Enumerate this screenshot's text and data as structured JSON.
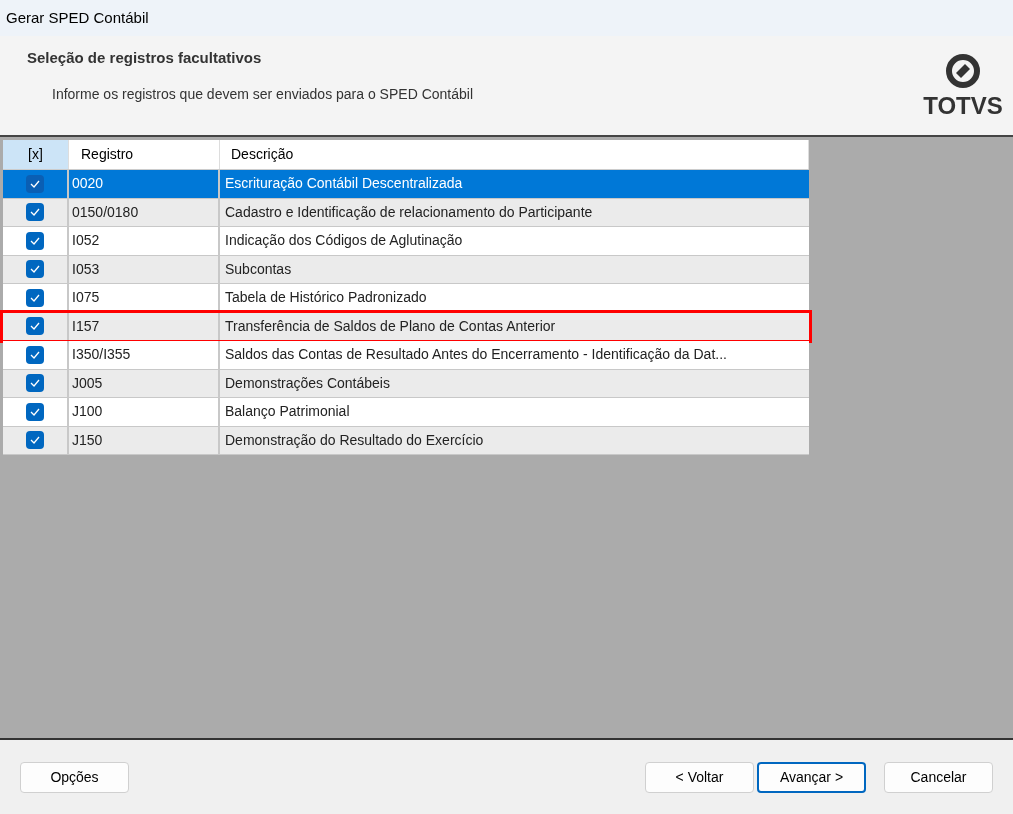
{
  "window": {
    "title": "Gerar SPED Contábil"
  },
  "header": {
    "title": "Seleção de registros facultativos",
    "subtitle": "Informe os registros que devem ser enviados para o SPED Contábil",
    "logo_text": "TOTVS"
  },
  "table": {
    "columns": [
      "[x]",
      "Registro",
      "Descrição"
    ],
    "rows": [
      {
        "checked": true,
        "selected": true,
        "highlighted": false,
        "registro": "0020",
        "descricao": "Escrituração Contábil Descentralizada"
      },
      {
        "checked": true,
        "selected": false,
        "highlighted": false,
        "registro": "0150/0180",
        "descricao": "Cadastro e Identificação de relacionamento do Participante"
      },
      {
        "checked": true,
        "selected": false,
        "highlighted": false,
        "registro": "I052",
        "descricao": "Indicação dos Códigos de Aglutinação"
      },
      {
        "checked": true,
        "selected": false,
        "highlighted": false,
        "registro": "I053",
        "descricao": "Subcontas"
      },
      {
        "checked": true,
        "selected": false,
        "highlighted": false,
        "registro": "I075",
        "descricao": "Tabela de Histórico Padronizado"
      },
      {
        "checked": true,
        "selected": false,
        "highlighted": true,
        "registro": "I157",
        "descricao": "Transferência de Saldos de Plano de Contas Anterior"
      },
      {
        "checked": true,
        "selected": false,
        "highlighted": false,
        "registro": "I350/I355",
        "descricao": "Saldos das Contas de Resultado Antes do Encerramento - Identificação da Dat..."
      },
      {
        "checked": true,
        "selected": false,
        "highlighted": false,
        "registro": "J005",
        "descricao": "Demonstrações Contábeis"
      },
      {
        "checked": true,
        "selected": false,
        "highlighted": false,
        "registro": "J100",
        "descricao": "Balanço Patrimonial"
      },
      {
        "checked": true,
        "selected": false,
        "highlighted": false,
        "registro": "J150",
        "descricao": "Demonstração do Resultado do Exercício"
      }
    ]
  },
  "footer": {
    "left_button": "Opções",
    "buttons": [
      {
        "label": "< Voltar",
        "default": false
      },
      {
        "label": "Avançar >",
        "default": true
      },
      {
        "label": "Cancelar",
        "default": false
      }
    ]
  }
}
